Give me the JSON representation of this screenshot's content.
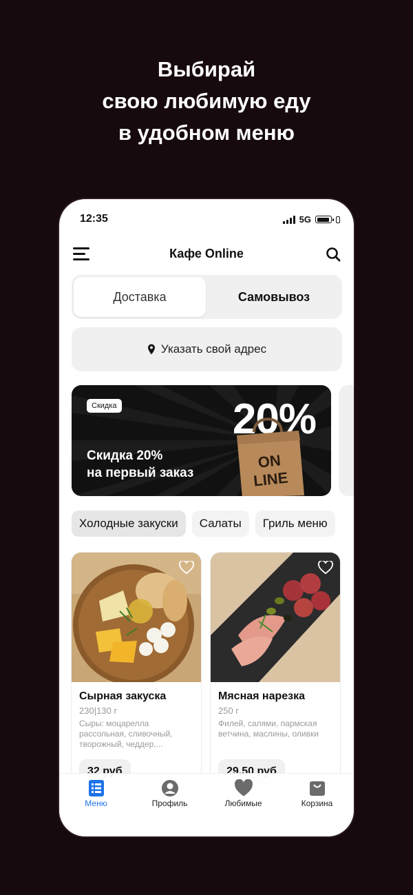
{
  "headline": [
    "Выбирай",
    "свою любимую еду",
    "в удобном меню"
  ],
  "status": {
    "time": "12:35",
    "network": "5G"
  },
  "app": {
    "title": "Кафе Online"
  },
  "delivery": {
    "options": [
      "Доставка",
      "Самовывоз"
    ],
    "selected": "Доставка"
  },
  "address": {
    "label": "Указать свой адрес"
  },
  "promo": {
    "badge": "Скидка",
    "percent": "20%",
    "line1": "Скидка 20%",
    "line2": "на первый заказ",
    "bag_text1": "ON",
    "bag_text2": "LINE"
  },
  "categories": [
    "Холодные закуски",
    "Салаты",
    "Гриль меню"
  ],
  "products": [
    {
      "name": "Сырная закуска",
      "weight": "230|130 г",
      "desc": "Сыры: моцарелла рассольная, сливочный, творожный, чеддер,...",
      "price": "32 руб"
    },
    {
      "name": "Мясная нарезка",
      "weight": "250 г",
      "desc": "Филей, салями, пармская ветчина, маслины, оливки",
      "price": "29,50 руб"
    }
  ],
  "tabs": [
    "Меню",
    "Профиль",
    "Любимые",
    "Корзина"
  ],
  "colors": {
    "background": "#170a0e",
    "accent": "#1e73e8"
  }
}
